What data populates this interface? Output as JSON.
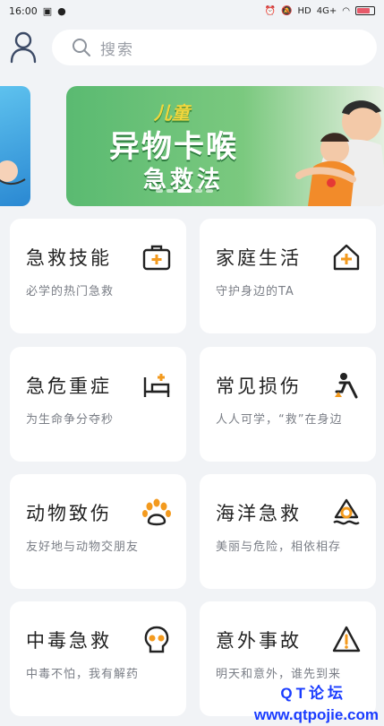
{
  "status_bar": {
    "time": "16:00",
    "network": "4G+",
    "battery_level": 0.8,
    "colors": {
      "battery": "#e75a6a"
    }
  },
  "search": {
    "placeholder": "搜索"
  },
  "banner": {
    "tag": "儿童",
    "title": "异物卡喉",
    "subtitle": "急救法",
    "active_slide": 2,
    "slide_count": 5,
    "colors": {
      "background": "#5aba71",
      "title": "#ffffff",
      "tag": "#f2d63c"
    }
  },
  "cards": [
    {
      "title": "急救技能",
      "subtitle": "必学的热门急救",
      "icon": "first-aid-kit-icon",
      "icon_color": "#f39a1e"
    },
    {
      "title": "家庭生活",
      "subtitle": "守护身边的TA",
      "icon": "house-plus-icon",
      "icon_color": "#f39a1e"
    },
    {
      "title": "急危重症",
      "subtitle": "为生命争分夺秒",
      "icon": "hospital-bed-icon",
      "icon_color": "#f39a1e"
    },
    {
      "title": "常见损伤",
      "subtitle": "人人可学，“救”在身边",
      "icon": "injured-person-icon",
      "icon_color": "#f39a1e"
    },
    {
      "title": "动物致伤",
      "subtitle": "友好地与动物交朋友",
      "icon": "paw-icon",
      "icon_color": "#f39a1e"
    },
    {
      "title": "海洋急救",
      "subtitle": "美丽与危险，相依相存",
      "icon": "ocean-buoy-icon",
      "icon_color": "#f39a1e"
    },
    {
      "title": "中毒急救",
      "subtitle": "中毒不怕，我有解药",
      "icon": "skull-icon",
      "icon_color": "#f39a1e"
    },
    {
      "title": "意外事故",
      "subtitle": "明天和意外，谁先到来",
      "icon": "warning-icon",
      "icon_color": "#f39a1e"
    }
  ],
  "watermark": {
    "line1": "QT论坛",
    "line2": "www.qtpojie.com"
  }
}
